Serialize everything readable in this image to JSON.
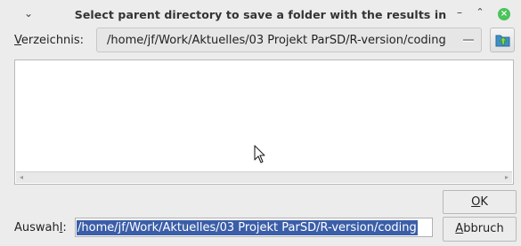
{
  "window": {
    "title": "Select parent directory to save a folder with the results in",
    "menu_glyph": "⌄",
    "minimize_glyph": "–",
    "maximize_glyph": "⌃",
    "close_glyph": "×",
    "close_color": "#4ac45a"
  },
  "directory": {
    "label_mnemonic": "V",
    "label_rest": "erzeichnis:",
    "path": "/home/jf/Work/Aktuelles/03 Projekt ParSD/R-version/coding",
    "up_button_icon": "folder-up-icon"
  },
  "file_list": {
    "items": [],
    "scroll_left_glyph": "◂",
    "scroll_right_glyph": "▸"
  },
  "selection": {
    "label_prefix": "Auswah",
    "label_mnemonic": "l",
    "label_suffix": ":",
    "value": "/home/jf/Work/Aktuelles/03 Projekt ParSD/R-version/coding",
    "highlight_color": "#3b5ea8"
  },
  "buttons": {
    "ok_mnemonic": "O",
    "ok_rest": "K",
    "cancel_mnemonic": "A",
    "cancel_rest": "bbruch"
  }
}
